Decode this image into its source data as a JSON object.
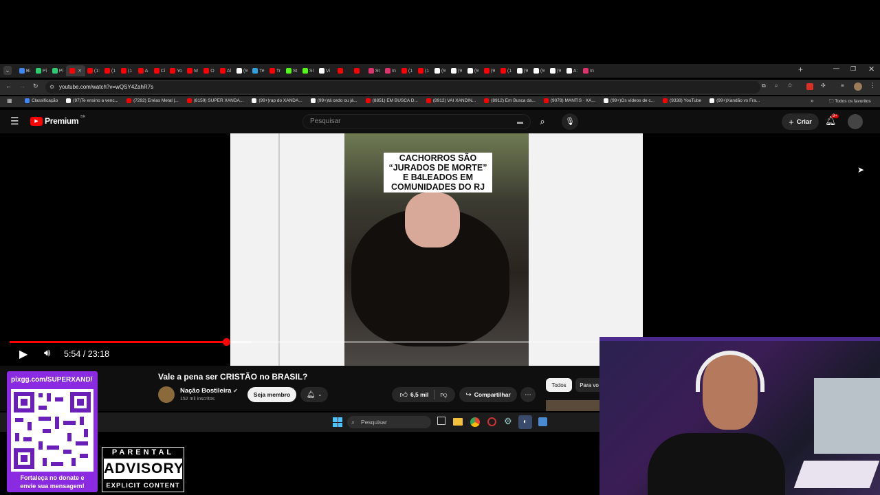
{
  "browser": {
    "tabs": [
      {
        "label": "Bi",
        "color": "#4285f4"
      },
      {
        "label": "Pi",
        "color": "#2ecc71"
      },
      {
        "label": "Pi",
        "color": "#2ecc71"
      },
      {
        "label": "",
        "color": "#ff0000",
        "active": true
      },
      {
        "label": "(1:",
        "color": "#ff0000"
      },
      {
        "label": "(1",
        "color": "#ff0000"
      },
      {
        "label": "(1",
        "color": "#ff0000"
      },
      {
        "label": "A",
        "color": "#ff0000"
      },
      {
        "label": "Ci",
        "color": "#ff0000"
      },
      {
        "label": "Yo",
        "color": "#ff0000"
      },
      {
        "label": "M",
        "color": "#ff0000"
      },
      {
        "label": "O",
        "color": "#ff0000"
      },
      {
        "label": "Al",
        "color": "#ff0000"
      },
      {
        "label": "(9",
        "color": "#ffffff"
      },
      {
        "label": "Te",
        "color": "#2aa3e0"
      },
      {
        "label": "Tr",
        "color": "#ff0000"
      },
      {
        "label": "St",
        "color": "#53fc18"
      },
      {
        "label": "SI",
        "color": "#53fc18"
      },
      {
        "label": "Vi",
        "color": "#ffffff"
      },
      {
        "label": "",
        "color": "#ff0000"
      },
      {
        "label": "",
        "color": "#ff0000"
      },
      {
        "label": "St",
        "color": "#e1306c"
      },
      {
        "label": "In",
        "color": "#e1306c"
      },
      {
        "label": "(1",
        "color": "#ff0000"
      },
      {
        "label": "(1",
        "color": "#ff0000"
      },
      {
        "label": "(9",
        "color": "#ffffff"
      },
      {
        "label": "(9",
        "color": "#ffffff"
      },
      {
        "label": "(9",
        "color": "#ffffff"
      },
      {
        "label": "(9",
        "color": "#ff0000"
      },
      {
        "label": "(1",
        "color": "#ff0000"
      },
      {
        "label": "(9",
        "color": "#ffffff"
      },
      {
        "label": "(9",
        "color": "#ffffff"
      },
      {
        "label": "(9",
        "color": "#ffffff"
      },
      {
        "label": "A:",
        "color": "#ffffff"
      },
      {
        "label": "In",
        "color": "#e1306c"
      }
    ],
    "url": "youtube.com/watch?v=wQSY4ZahR7s",
    "bookmarks": [
      {
        "label": "Classificação",
        "color": "#4285f4"
      },
      {
        "label": "(97)Te ensino a venc...",
        "color": "#ffffff"
      },
      {
        "label": "(7292) Enéas Metal |...",
        "color": "#ff0000"
      },
      {
        "label": "(8159) SUPER XANDÃ...",
        "color": "#ff0000"
      },
      {
        "label": "(99+)rap do XANDÃ...",
        "color": "#ffffff"
      },
      {
        "label": "(99+)tá cedo ou já...",
        "color": "#ffffff"
      },
      {
        "label": "(8851) EM BUSCA D...",
        "color": "#ff0000"
      },
      {
        "label": "(8912) VAI XANDIN...",
        "color": "#ff0000"
      },
      {
        "label": "(8912) Em Busca da...",
        "color": "#ff0000"
      },
      {
        "label": "(9078) MANTIS · XA...",
        "color": "#ff0000"
      },
      {
        "label": "(99+)Os vídeos de c...",
        "color": "#ffffff"
      },
      {
        "label": "(9338) YouTube",
        "color": "#ff0000"
      },
      {
        "label": "(99+)Xandão vs Fra...",
        "color": "#ffffff"
      }
    ],
    "all_bookmarks": "Todos os favoritos"
  },
  "youtube": {
    "logo_text": "Premium",
    "logo_region": "BR",
    "search_placeholder": "Pesquisar",
    "create_label": "Criar",
    "notif_count": "9+",
    "overlay_text": "CACHORROS SÃO “JURADOS DE MORTE” E B4LEADOS EM COMUNIDADES DO RJ",
    "progress_fraction": 0.367,
    "buffer_fraction": 0.41,
    "time_current": "5:54",
    "time_separator": "/",
    "time_total": "23:18",
    "video_title": "Vale a pena ser CRISTÃO no BRASIL?",
    "channel_name": "Nação Bostileira",
    "subscribers": "152 mil inscritos",
    "join_label": "Seja membro",
    "likes": "6,5 mil",
    "share_label": "Compartilhar",
    "chip_all": "Todos",
    "chip_for_you": "Para vo"
  },
  "taskbar": {
    "search_placeholder": "Pesquisar"
  },
  "stream_overlay": {
    "donate_url": "pixgg.com/SUPERXAND/",
    "donate_text_1": "Fortaleça no donate e",
    "donate_text_2": "envie sua mensagem!",
    "advisory_top": "PARENTAL",
    "advisory_mid": "ADVISORY",
    "advisory_bottom": "EXPLICIT CONTENT"
  }
}
